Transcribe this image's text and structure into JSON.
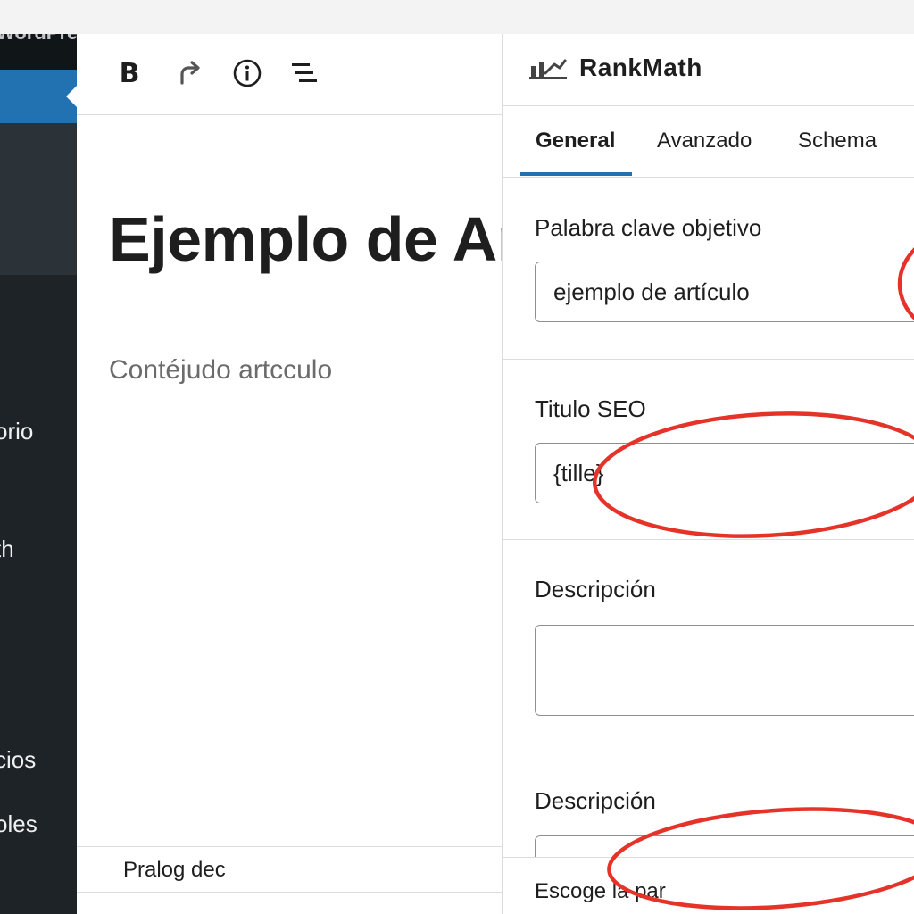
{
  "admin_sidebar": {
    "top_label": "WordPress",
    "items": [
      {
        "label": "orio"
      },
      {
        "label": "th"
      },
      {
        "label": "ı"
      },
      {
        "label": "cios"
      },
      {
        "label": "oles"
      }
    ]
  },
  "editor": {
    "toolbar": {
      "bold_label": "B",
      "redo_icon": "redo-icon",
      "info_icon": "info-icon",
      "list_view_icon": "list-view-icon"
    },
    "title": "Ejemplo de Artículo",
    "content": "Contéjudo artcculo",
    "footer_text": "Pralog dec"
  },
  "panel": {
    "title": "RankMath",
    "logo_icon": "rankmath-logo-icon",
    "tabs": [
      {
        "label": "General",
        "active": true
      },
      {
        "label": "Avanzado",
        "active": false
      },
      {
        "label": "Schema",
        "active": false
      }
    ],
    "fields": {
      "focus_keyword": {
        "label": "Palabra clave objetivo",
        "value": "ejemplo de artículo"
      },
      "seo_title": {
        "label": "Titulo SEO",
        "value": "{tille}"
      },
      "description_1": {
        "label": "Descripción",
        "value": ""
      },
      "description_2": {
        "label": "Descripción",
        "value": ""
      }
    },
    "bottom_text": "Escoge la par"
  },
  "colors": {
    "admin_bg": "#1d2327",
    "admin_accent": "#2271b1",
    "tab_underline": "#2271b1",
    "annotation_red": "#e5332a"
  }
}
